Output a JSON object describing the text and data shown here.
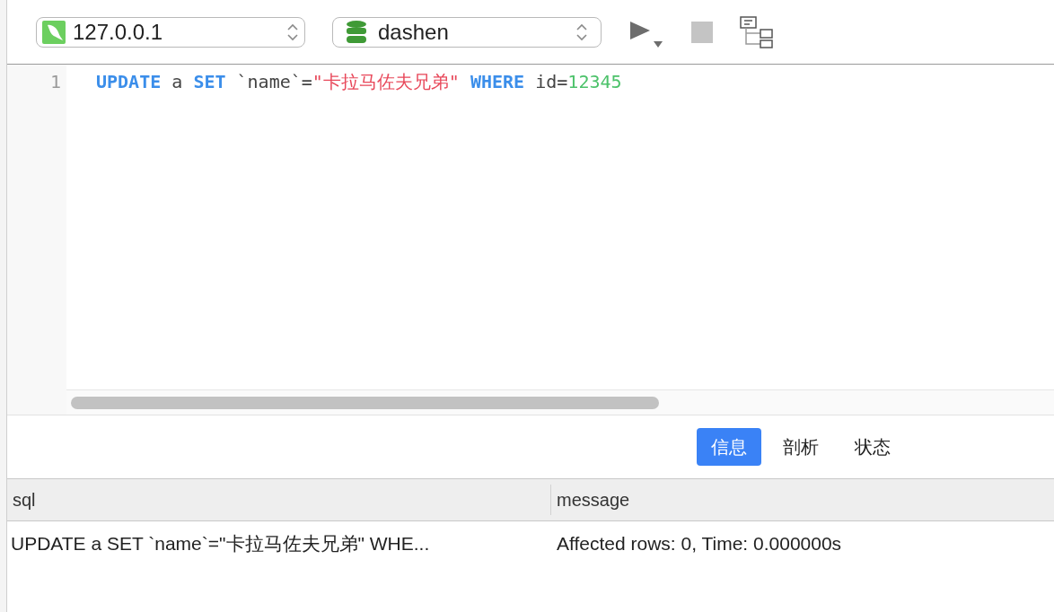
{
  "toolbar": {
    "connection": "127.0.0.1",
    "database": "dashen"
  },
  "editor": {
    "lines": [
      {
        "number": "1",
        "tokens": [
          {
            "kind": "keyword",
            "text": "UPDATE"
          },
          {
            "kind": "plain",
            "text": " a "
          },
          {
            "kind": "keyword",
            "text": "SET"
          },
          {
            "kind": "plain",
            "text": " `name`="
          },
          {
            "kind": "string",
            "text": "\"卡拉马佐夫兄弟\" "
          },
          {
            "kind": "keyword",
            "text": "WHERE"
          },
          {
            "kind": "plain",
            "text": " id="
          },
          {
            "kind": "number",
            "text": "12345"
          }
        ]
      }
    ]
  },
  "result_tabs": [
    {
      "label": "信息",
      "selected": true
    },
    {
      "label": "剖析",
      "selected": false
    },
    {
      "label": "状态",
      "selected": false
    }
  ],
  "table": {
    "columns": [
      "sql",
      "message"
    ],
    "rows": [
      [
        "UPDATE a SET `name`=\"卡拉马佐夫兄弟\" WHE...",
        "Affected rows: 0, Time: 0.000000s"
      ]
    ]
  }
}
